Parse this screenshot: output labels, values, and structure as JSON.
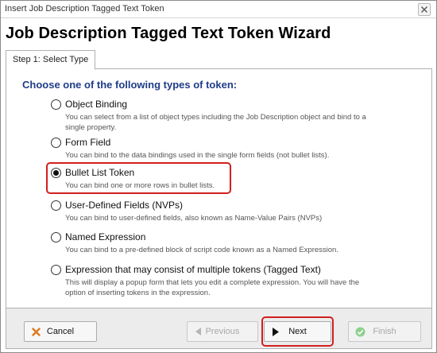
{
  "window": {
    "title": "Insert Job Description Tagged Text Token"
  },
  "wizard": {
    "title": "Job Description Tagged Text Token Wizard",
    "tab_label": "Step 1: Select Type",
    "heading": "Choose one of the following types of token:"
  },
  "options": [
    {
      "label": "Object Binding",
      "desc_line1": "You can select from a list of object types including the Job Description object and bind to a",
      "desc_line2": "single property.",
      "selected": false
    },
    {
      "label": "Form Field",
      "desc_line1": "You can bind to the data bindings used in the single form fields (not bullet lists).",
      "desc_line2": "",
      "selected": false
    },
    {
      "label": "Bullet List Token",
      "desc_line1": "You can bind one or more rows in bullet lists.",
      "desc_line2": "",
      "selected": true
    },
    {
      "label": "User-Defined Fields (NVPs)",
      "desc_line1": "You can bind to user-defined fields, also known as Name-Value Pairs (NVPs)",
      "desc_line2": "",
      "selected": false
    },
    {
      "label": "Named Expression",
      "desc_line1": "You can bind to a pre-defined block of script code known as a Named Expression.",
      "desc_line2": "",
      "selected": false
    },
    {
      "label": "Expression that may consist of multiple tokens (Tagged Text)",
      "desc_line1": "This will display a popup form that lets you edit a complete expression. You will have the",
      "desc_line2": "option of inserting tokens in the expression.",
      "selected": false
    }
  ],
  "footer": {
    "cancel_label": "Cancel",
    "previous_label": "Previous",
    "next_label": "Next",
    "finish_label": "Finish"
  },
  "colors": {
    "heading": "#1f3c88",
    "highlight": "#d21f1f",
    "cancel_icon": "#e07a1f",
    "finish_icon": "#8fd08f"
  },
  "icons": {
    "close": "close-icon",
    "cancel": "cancel-x-icon",
    "previous": "triangle-left-icon",
    "next": "triangle-right-icon",
    "finish": "check-circle-icon"
  }
}
